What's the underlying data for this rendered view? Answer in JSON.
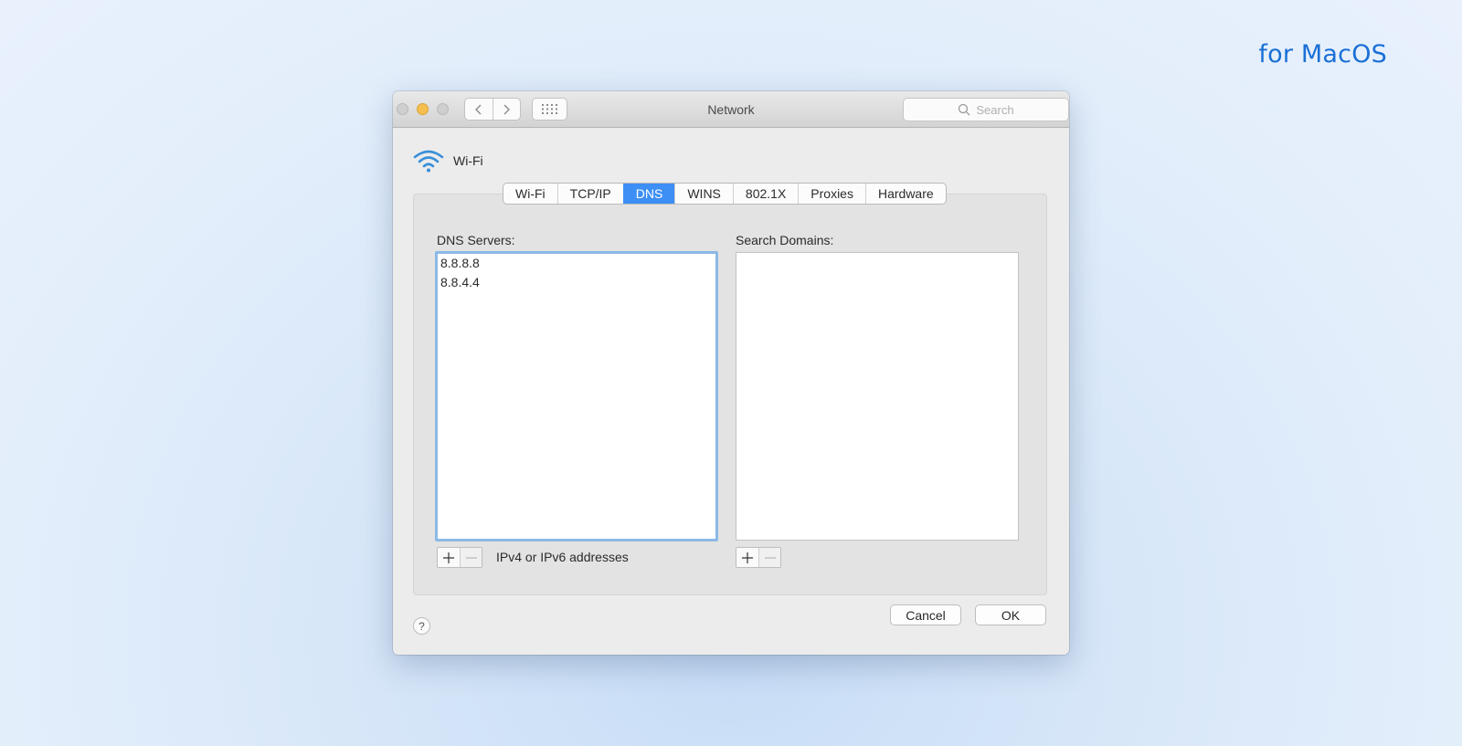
{
  "tagline": "for MacOS",
  "window": {
    "title": "Network",
    "search_placeholder": "Search"
  },
  "interface": {
    "name": "Wi-Fi",
    "icon": "wifi-icon"
  },
  "tabs": [
    {
      "label": "Wi-Fi",
      "active": false
    },
    {
      "label": "TCP/IP",
      "active": false
    },
    {
      "label": "DNS",
      "active": true
    },
    {
      "label": "WINS",
      "active": false
    },
    {
      "label": "802.1X",
      "active": false
    },
    {
      "label": "Proxies",
      "active": false
    },
    {
      "label": "Hardware",
      "active": false
    }
  ],
  "dns": {
    "label": "DNS Servers:",
    "servers": [
      "8.8.8.8",
      "8.8.4.4"
    ],
    "hint": "IPv4 or IPv6 addresses"
  },
  "search_domains": {
    "label": "Search Domains:",
    "items": []
  },
  "buttons": {
    "help": "?",
    "cancel": "Cancel",
    "ok": "OK"
  },
  "colors": {
    "accent": "#3d8ff5",
    "tagline": "#1a6fd6",
    "minimize": "#f5be4f"
  }
}
